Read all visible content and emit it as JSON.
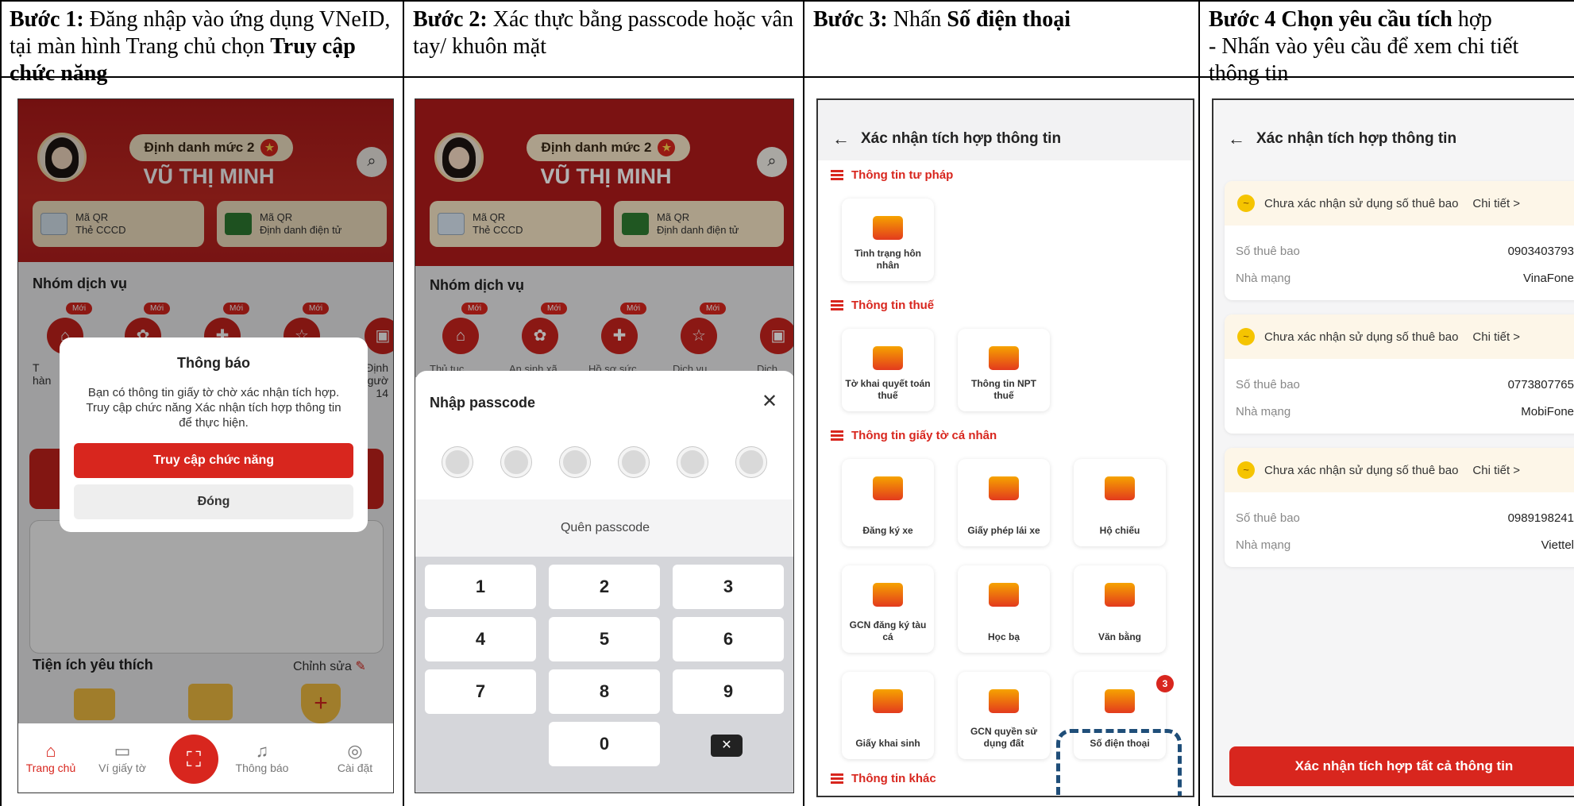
{
  "steps": [
    {
      "bold": "Bước 1:",
      "text1": " Đăng nhập vào ứng dụng VNeID, tại màn hình Trang chủ chọn ",
      "bold2": "Truy cập chức năng"
    },
    {
      "bold": "Bước 2:",
      "text1": " Xác thực bằng passcode hoặc vân tay/ khuôn mặt"
    },
    {
      "bold": "Bước 3:",
      "text1": " Nhấn ",
      "bold2": "Số điện thoại"
    },
    {
      "bold": "Bước 4 Chọn yêu cầu tích",
      "text1": " hợp",
      "line2": "- Nhấn vào yêu cầu để xem chi tiết thông tin"
    }
  ],
  "home": {
    "level": "Định danh mức 2",
    "name": "VŨ THỊ MINH",
    "qr1_a": "Mã QR",
    "qr1_b": "Thẻ CCCD",
    "qr2_a": "Mã QR",
    "qr2_b": "Định danh điện tử",
    "group_title": "Nhóm dịch vụ",
    "new_badge": "Mới",
    "partial_left_1": "T",
    "partial_left_2": "hàn",
    "partial_right_1": "Định",
    "partial_right_2": "gườ",
    "partial_right_3": "14",
    "favorites": "Tiện ích yêu thích",
    "edit": "Chỉnh sửa",
    "modal_title": "Thông báo",
    "modal_body": "Bạn có thông tin giấy tờ chờ xác nhận tích hợp. Truy cập chức năng Xác nhận tích hợp thông tin để thực hiện.",
    "modal_primary": "Truy cập chức năng",
    "modal_close": "Đóng",
    "nav": [
      "Trang chủ",
      "Ví giấy tờ",
      "Thông báo",
      "Cài đặt"
    ]
  },
  "passcode": {
    "level": "Định danh mức 2",
    "name": "VŨ THỊ MINH",
    "qr1_a": "Mã QR",
    "qr1_b": "Thẻ CCCD",
    "qr2_a": "Mã QR",
    "qr2_b": "Định danh điện tử",
    "group_title": "Nhóm dịch vụ",
    "new_badge": "Mới",
    "svc_labels": [
      "Thủ tục",
      "An sinh xã",
      "Hồ sơ sức",
      "Dịch vụ",
      "Dịch"
    ],
    "title": "Nhập passcode",
    "forgot": "Quên passcode",
    "keys": [
      "1",
      "2",
      "3",
      "4",
      "5",
      "6",
      "7",
      "8",
      "9",
      "0"
    ]
  },
  "integrate": {
    "title": "Xác nhận tích hợp thông tin",
    "sections": [
      "Thông tin tư pháp",
      "Thông tin thuế",
      "Thông tin giấy tờ cá nhân",
      "Thông tin khác"
    ],
    "cards": [
      "Tình trạng hôn nhân",
      "Tờ khai quyết toán thuế",
      "Thông tin NPT thuế",
      "Đăng ký xe",
      "Giấy phép lái xe",
      "Hộ chiếu",
      "GCN đăng ký tàu cá",
      "Học bạ",
      "Văn bằng",
      "Giấy khai sinh",
      "GCN quyền sử dụng đất",
      "Số điện thoại"
    ],
    "phone_badge": "3"
  },
  "requests": {
    "title": "Xác nhận tích hợp thông tin",
    "status": "Chưa xác nhận sử dụng số thuê bao",
    "detail": "Chi tiết >",
    "label_number": "Số thuê bao",
    "label_carrier": "Nhà mạng",
    "items": [
      {
        "number": "0903403793",
        "carrier": "VinaFone"
      },
      {
        "number": "0773807765",
        "carrier": "MobiFone"
      },
      {
        "number": "0989198241",
        "carrier": "Viettel"
      }
    ],
    "confirm_all": "Xác nhận tích hợp tất cả thông tin"
  }
}
